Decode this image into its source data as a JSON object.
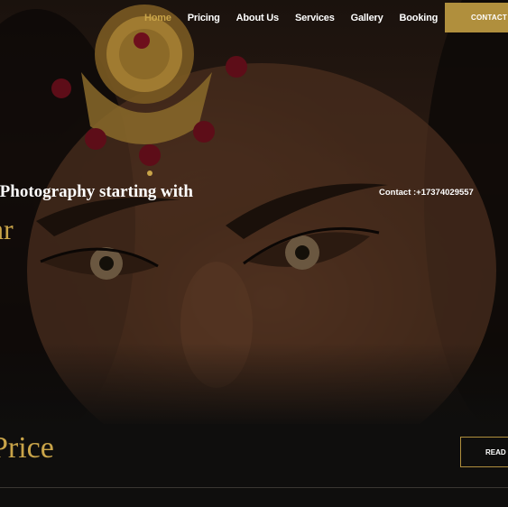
{
  "nav": {
    "items": [
      {
        "label": "Home",
        "active": true
      },
      {
        "label": "Pricing",
        "active": false
      },
      {
        "label": "About Us",
        "active": false
      },
      {
        "label": "Services",
        "active": false
      },
      {
        "label": "Gallery",
        "active": false
      },
      {
        "label": "Booking",
        "active": false
      }
    ],
    "contact_button": "CONTACT"
  },
  "hero": {
    "headline": "nt Photography starting with",
    "headline_2": "hr",
    "contact_line": "Contact :+17374029557"
  },
  "pricing": {
    "title": "Price",
    "read_button": "READ"
  },
  "colors": {
    "accent": "#b08f3d",
    "accent_text": "#c9a449",
    "background": "#0f0e0d"
  }
}
